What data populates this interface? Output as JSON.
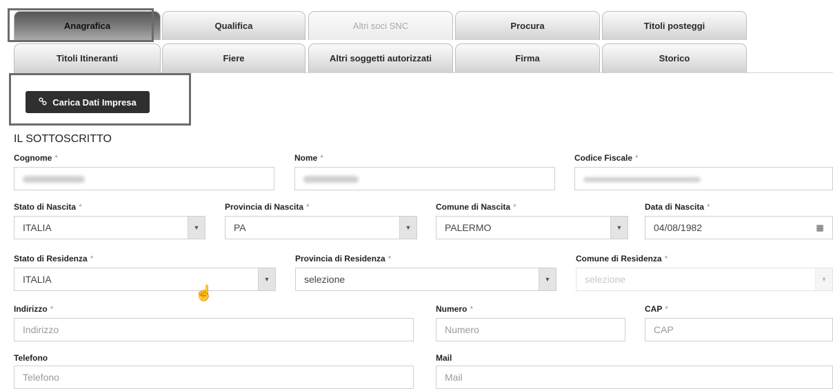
{
  "tabs_row1": [
    {
      "label": "Anagrafica",
      "state": "active"
    },
    {
      "label": "Qualifica",
      "state": "normal"
    },
    {
      "label": "Altri soci SNC",
      "state": "disabled"
    },
    {
      "label": "Procura",
      "state": "normal"
    },
    {
      "label": "Titoli posteggi",
      "state": "normal"
    }
  ],
  "tabs_row2": [
    {
      "label": "Titoli Itineranti"
    },
    {
      "label": "Fiere"
    },
    {
      "label": "Altri soggetti autorizzati"
    },
    {
      "label": "Firma"
    },
    {
      "label": "Storico"
    }
  ],
  "load_button": {
    "label": "Carica Dati Impresa",
    "icon": "link-icon"
  },
  "section_title": "IL SOTTOSCRITTO",
  "required_mark": "*",
  "form": {
    "cognome": {
      "label": "Cognome",
      "required": true,
      "value_blurred": true
    },
    "nome": {
      "label": "Nome",
      "required": true,
      "value_blurred": true
    },
    "codice_fiscale": {
      "label": "Codice Fiscale",
      "required": true,
      "value_blurred": true
    },
    "stato_nascita": {
      "label": "Stato di Nascita",
      "required": true,
      "value": "ITALIA"
    },
    "provincia_nascita": {
      "label": "Provincia di Nascita",
      "required": true,
      "value": "PA"
    },
    "comune_nascita": {
      "label": "Comune di Nascita",
      "required": true,
      "value": "PALERMO"
    },
    "data_nascita": {
      "label": "Data di Nascita",
      "required": true,
      "value": "04/08/1982",
      "icon": "calendar-icon"
    },
    "stato_residenza": {
      "label": "Stato di Residenza",
      "required": true,
      "value": "ITALIA"
    },
    "provincia_residenza": {
      "label": "Provincia di Residenza",
      "required": true,
      "value": "selezione"
    },
    "comune_residenza": {
      "label": "Comune di Residenza",
      "required": true,
      "value": "selezione",
      "disabled": true
    },
    "indirizzo": {
      "label": "Indirizzo",
      "required": true,
      "placeholder": "Indirizzo"
    },
    "numero": {
      "label": "Numero",
      "required": true,
      "placeholder": "Numero"
    },
    "cap": {
      "label": "CAP",
      "required": true,
      "placeholder": "CAP"
    },
    "telefono": {
      "label": "Telefono",
      "required": false,
      "placeholder": "Telefono"
    },
    "mail": {
      "label": "Mail",
      "required": false,
      "placeholder": "Mail"
    }
  },
  "colors": {
    "button_bg": "#2f2f2f",
    "highlight_border": "#6b6b6b",
    "required_star": "#999999"
  }
}
